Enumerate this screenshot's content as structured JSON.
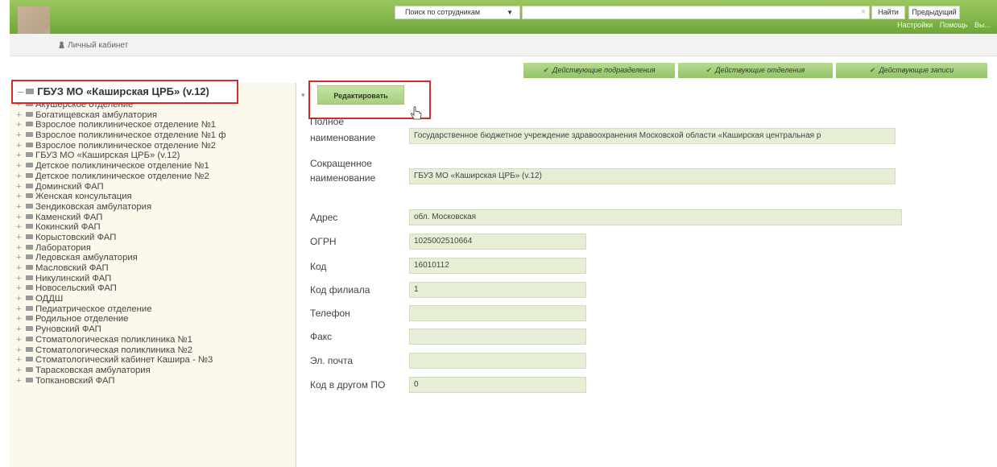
{
  "header": {
    "app_title": "ГБУЗ МО «Каширская ЦРБ» (v.12)",
    "top_links": [
      "Настройки",
      "Помощь",
      "Вы..."
    ],
    "cabinet_label": "Личный кабинет"
  },
  "search": {
    "mode_label": "Поиск по сотрудникам",
    "query": "",
    "find_label": "Найти",
    "prev_label": "Предыдущий"
  },
  "filters": [
    "Действующие подразделения",
    "Действующие отделения",
    "Действующие записи"
  ],
  "tree": {
    "root_label": "ГБУЗ МО «Каширская ЦРБ» (v.12)",
    "items": [
      "Акушерское отделение",
      "Богатищевская амбулатория",
      "Взрослое поликлиническое отделение №1",
      "Взрослое поликлиническое отделение №1 ф",
      "Взрослое поликлиническое отделение №2",
      "ГБУЗ МО «Каширская ЦРБ» (v.12)",
      "Детское поликлиническое отделение №1",
      "Детское поликлиническое отделение №2",
      "Доминский ФАП",
      "Женская консультация",
      "Зендиковская амбулатория",
      "Каменский ФАП",
      "Кокинский ФАП",
      "Корыстовский ФАП",
      "Лаборатория",
      "Ледовская амбулатория",
      "Масловский ФАП",
      "Никулинский ФАП",
      "Новосельский ФАП",
      "ОДДШ",
      "Педиатрическое отделение",
      "Родильное отделение",
      "Руновский ФАП",
      "Стоматологическая поликлиника №1",
      "Стоматологическая поликлиника №2",
      "Стоматологический кабинет Кашира - №3",
      "Тарасковская амбулатория",
      "Топкановский ФАП"
    ]
  },
  "form": {
    "edit_label": "Редактировать",
    "full_name_label_1": "Полное",
    "full_name_label_2": "наименование",
    "full_name_value": "Государственное бюджетное учреждение здравоохранения Московской области «Каширская центральная р",
    "short_name_label_1": "Сокращенное",
    "short_name_label_2": "наименование",
    "short_name_value": "ГБУЗ МО «Каширская ЦРБ» (v.12)",
    "address_label": "Адрес",
    "address_value": "обл. Московская",
    "ogrn_label": "ОГРН",
    "ogrn_value": "1025002510664",
    "code_label": "Код",
    "code_value": "16010112",
    "branch_code_label": "Код филиала",
    "branch_code_value": "1",
    "phone_label": "Телефон",
    "phone_value": "",
    "fax_label": "Факс",
    "fax_value": "",
    "email_label": "Эл. почта",
    "email_value": "",
    "other_code_label": "Код в другом ПО",
    "other_code_value": "0"
  },
  "colors": {
    "accent_green": "#8dc063",
    "highlight_red": "#d02d2d",
    "field_bg": "#e6efd6"
  }
}
